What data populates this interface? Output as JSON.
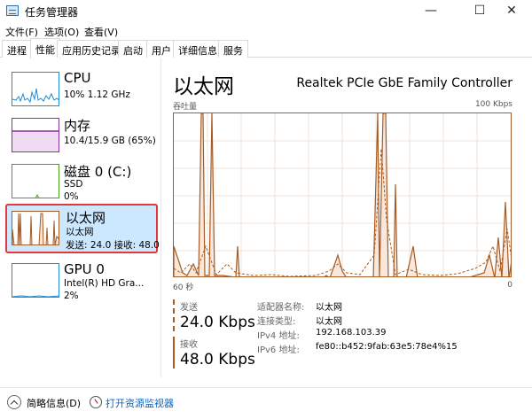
{
  "window": {
    "title": "任务管理器",
    "minimize": "—",
    "maximize": "☐",
    "close": "✕"
  },
  "menu": [
    "文件(F)",
    "选项(O)",
    "查看(V)"
  ],
  "tabs": [
    "进程",
    "性能",
    "应用历史记录",
    "启动",
    "用户",
    "详细信息",
    "服务"
  ],
  "active_tab": "性能",
  "sidebar": {
    "cpu": {
      "title": "CPU",
      "sub1": "10% 1.12 GHz"
    },
    "memory": {
      "title": "内存",
      "sub1": "10.4/15.9 GB (65%)"
    },
    "disk": {
      "title": "磁盘 0 (C:)",
      "sub1": "SSD",
      "sub2": "0%"
    },
    "ethernet": {
      "title": "以太网",
      "sub1": "以太网",
      "sub2": "发送: 24.0  接收: 48.0"
    },
    "gpu": {
      "title": "GPU 0",
      "sub1": "Intel(R) HD Gra...",
      "sub2": "2%"
    }
  },
  "main": {
    "title": "以太网",
    "adapter": "Realtek PCIe GbE Family Controller",
    "graph_label": "吞吐量",
    "graph_max": "100 Kbps",
    "graph_time": "60 秒",
    "graph_zero": "0",
    "send_label": "发送",
    "send_value": "24.0 Kbps",
    "recv_label": "接收",
    "recv_value": "48.0 Kbps",
    "info": [
      {
        "key": "适配器名称:",
        "value": "以太网"
      },
      {
        "key": "连接类型:",
        "value": "以太网"
      },
      {
        "key": "IPv4 地址:",
        "value": "192.168.103.39"
      },
      {
        "key": "IPv6 地址:",
        "value": "fe80::b452:9fab:63e5:78e4%15"
      }
    ]
  },
  "footer": {
    "brief": "简略信息(D)",
    "resmon": "打开资源监视器"
  },
  "colors": {
    "cpu": "#1f8bd6",
    "memory": "#8b2fa3",
    "disk": "#4aa21a",
    "ethernet": "#a75b24",
    "gpu": "#1f8bd6",
    "selected_bg": "#cce8ff",
    "highlight": "#e0383b"
  }
}
